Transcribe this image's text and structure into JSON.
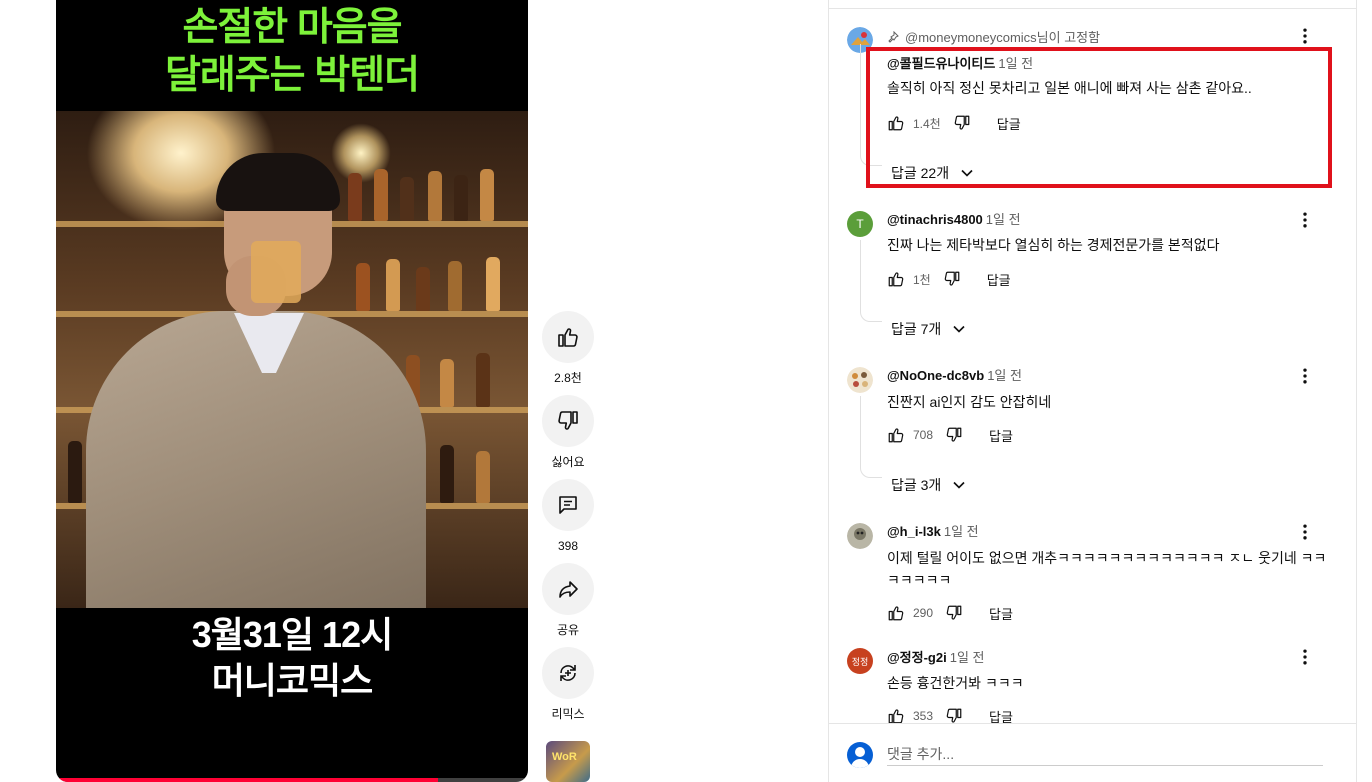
{
  "video": {
    "caption_top_line1": "손절한 마음을",
    "caption_top_line2": "달래주는 박텐더",
    "caption_bottom_line1": "3월31일 12시",
    "caption_bottom_line2": "머니코믹스",
    "progress_fraction": 0.81,
    "progress_color": "#ff0033"
  },
  "actions": {
    "like_label": "2.8천",
    "dislike_label": "싫어요",
    "comments_label": "398",
    "share_label": "공유",
    "remix_label": "리믹스",
    "sound_thumb_text": "WoR"
  },
  "comments": [
    {
      "pinned_text": "@moneymoneycomics님이 고정함",
      "author": "@콜필드유나이티드",
      "time": "1일 전",
      "text": "솔직히 아직 정신 못차리고 일본 애니에 빠져 사는 삼촌 같아요..",
      "likes": "1.4천",
      "reply_label": "답글",
      "replies_label": "답글 22개",
      "avatar_color": "#6aa8e6"
    },
    {
      "author": "@tinachris4800",
      "time": "1일 전",
      "text": "진짜 나는 제타박보다 열심히 하는 경제전문가를 본적없다",
      "likes": "1천",
      "reply_label": "답글",
      "replies_label": "답글 7개",
      "avatar_letter": "T",
      "avatar_color": "#5b9e3a"
    },
    {
      "author": "@NoOne-dc8vb",
      "time": "1일 전",
      "text": "진짠지 ai인지 감도 안잡히네",
      "likes": "708",
      "reply_label": "답글",
      "replies_label": "답글 3개",
      "avatar_color": "#d9b47a"
    },
    {
      "author": "@h_i-l3k",
      "time": "1일 전",
      "text": "이제 털릴 어이도 없으면 개추ㅋㅋㅋㅋㅋㅋㅋㅋㅋㅋㅋㅋㅋ ㅈㄴ 웃기네 ㅋㅋㅋㅋㅋㅋㅋ",
      "likes": "290",
      "reply_label": "답글",
      "avatar_color": "#8c8c7c"
    },
    {
      "author": "@정정-g2i",
      "time": "1일 전",
      "text": "손등 흉건한거봐 ㅋㅋㅋ",
      "likes": "353",
      "reply_label": "답글",
      "avatar_letter": "정정",
      "avatar_color": "#c7411f"
    }
  ],
  "add_comment": {
    "placeholder": "댓글 추가..."
  },
  "highlight_color": "#e0111b"
}
